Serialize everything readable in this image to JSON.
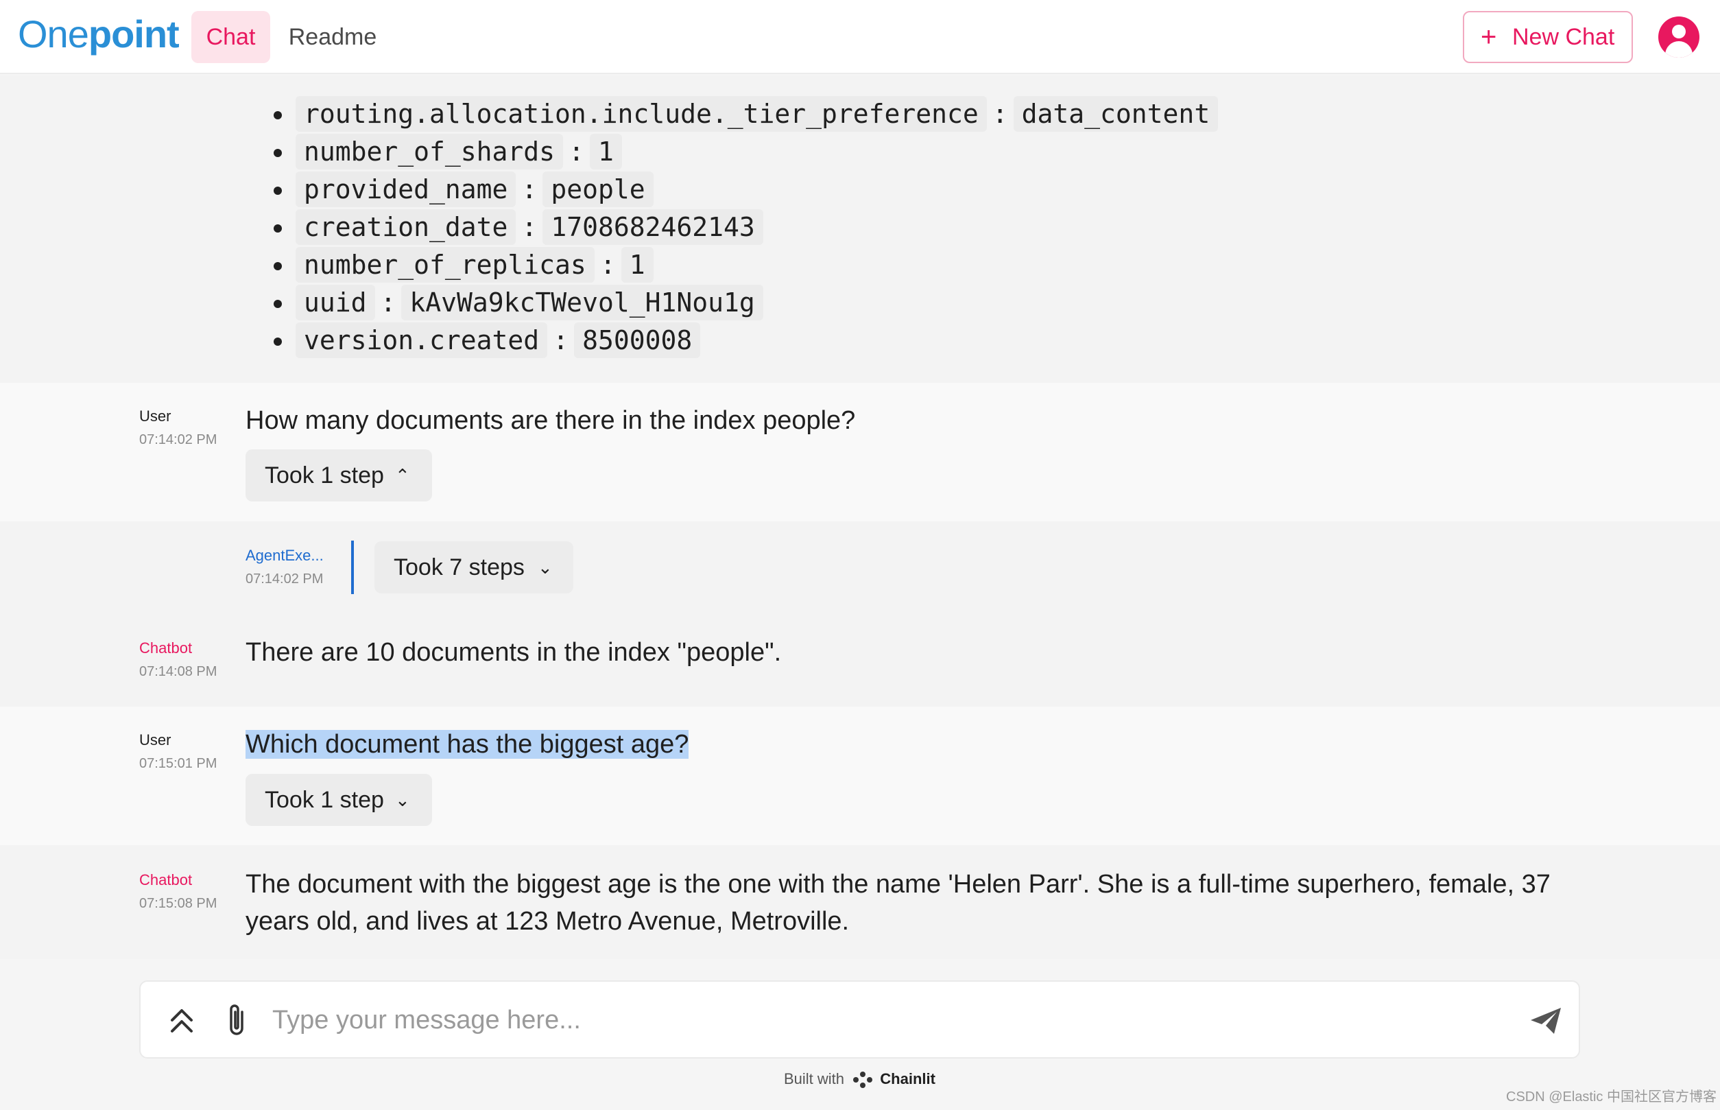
{
  "header": {
    "logo_part1": "One",
    "logo_part2": "point",
    "tabs": [
      {
        "label": "Chat",
        "active": true
      },
      {
        "label": "Readme",
        "active": false
      }
    ],
    "new_chat_label": "New Chat",
    "accent_color": "#e8185f",
    "logo_color": "#2a8fd6"
  },
  "index_settings": [
    {
      "key": "routing.allocation.include._tier_preference",
      "value": "data_content"
    },
    {
      "key": "number_of_shards",
      "value": "1"
    },
    {
      "key": "provided_name",
      "value": "people"
    },
    {
      "key": "creation_date",
      "value": "1708682462143"
    },
    {
      "key": "number_of_replicas",
      "value": "1"
    },
    {
      "key": "uuid",
      "value": "kAvWa9kcTWevol_H1Nou1g"
    },
    {
      "key": "version.created",
      "value": "8500008"
    }
  ],
  "messages": [
    {
      "author": "User",
      "time": "07:14:02 PM",
      "text": "How many documents are there in the index people?",
      "steps": "Took 1 step",
      "expanded": true
    },
    {
      "author": "AgentExe...",
      "time": "07:14:02 PM",
      "steps": "Took 7 steps",
      "expanded": false
    },
    {
      "author": "Chatbot",
      "time": "07:14:08 PM",
      "text": "There are 10 documents in the index \"people\"."
    },
    {
      "author": "User",
      "time": "07:15:01 PM",
      "text": "Which document has the biggest age?",
      "steps": "Took 1 step",
      "expanded": false
    },
    {
      "author": "Chatbot",
      "time": "07:15:08 PM",
      "text": "The document with the biggest age is the one with the name 'Helen Parr'. She is a full-time superhero, female, 37 years old, and lives at 123 Metro Avenue, Metroville."
    }
  ],
  "composer": {
    "placeholder": "Type your message here..."
  },
  "footer": {
    "built_with": "Built with",
    "brand": "Chainlit"
  },
  "watermark": "CSDN @Elastic 中国社区官方博客"
}
